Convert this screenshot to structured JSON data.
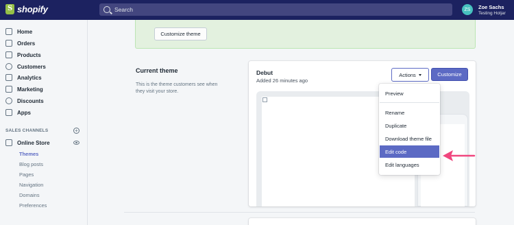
{
  "topbar": {
    "logo_text": "shopify",
    "search_placeholder": "Search",
    "avatar_initials": "ZS",
    "user_name": "Zoe Sachs",
    "store_name": "Testing Hotjar"
  },
  "sidebar": {
    "items": [
      {
        "label": "Home",
        "icon": "home-icon"
      },
      {
        "label": "Orders",
        "icon": "orders-icon"
      },
      {
        "label": "Products",
        "icon": "tag-icon"
      },
      {
        "label": "Customers",
        "icon": "person-icon"
      },
      {
        "label": "Analytics",
        "icon": "bar-chart-icon"
      },
      {
        "label": "Marketing",
        "icon": "megaphone-icon"
      },
      {
        "label": "Discounts",
        "icon": "discount-icon"
      },
      {
        "label": "Apps",
        "icon": "apps-icon"
      }
    ],
    "section_label": "SALES CHANNELS",
    "channel": {
      "label": "Online Store",
      "icon": "store-icon"
    },
    "sub_items": [
      "Themes",
      "Blog posts",
      "Pages",
      "Navigation",
      "Domains",
      "Preferences"
    ],
    "active_sub": "Themes"
  },
  "banner": {
    "button_label": "Customize theme"
  },
  "current_theme": {
    "heading": "Current theme",
    "description": "This is the theme customers see when they visit your store."
  },
  "theme_card": {
    "name": "Debut",
    "added": "Added 26 minutes ago",
    "actions_label": "Actions",
    "customize_label": "Customize"
  },
  "actions_menu": {
    "items": [
      "Preview",
      "Rename",
      "Duplicate",
      "Download theme file",
      "Edit code",
      "Edit languages"
    ],
    "highlighted": "Edit code"
  },
  "colors": {
    "topbar": "#1c2260",
    "accent": "#5c6ac4",
    "arrow": "#f0467e",
    "banner": "#e3f1df"
  }
}
